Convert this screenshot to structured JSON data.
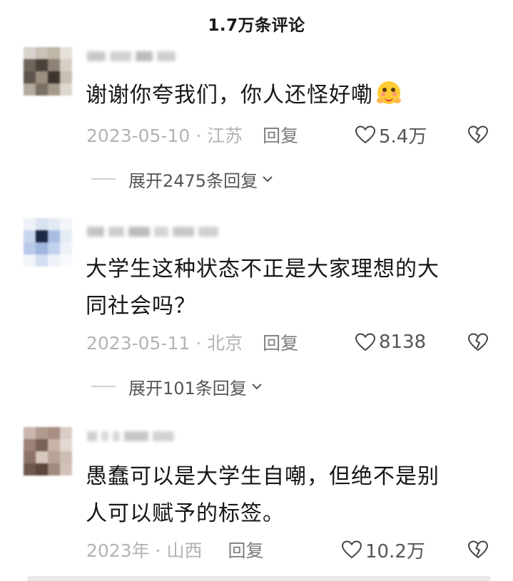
{
  "header": {
    "title": "1.7万条评论"
  },
  "comments": [
    {
      "text": "谢谢你夸我们，你人还怪好嘞",
      "emoji": "hugging-face-icon",
      "date_location": "2023-05-10 · 江苏",
      "reply_label": "回复",
      "likes": "5.4万",
      "expand_label": "展开2475条回复"
    },
    {
      "text": "大学生这种状态不正是大家理想的大\n同社会吗？",
      "date_location": "2023-05-11 · 北京",
      "reply_label": "回复",
      "likes": "8138",
      "expand_label": "展开101条回复"
    },
    {
      "text": "愚蠢可以是大学生自嘲，但绝不是别\n人可以赋予的标签。",
      "date_location": "2023年 · 山西",
      "reply_label": "回复",
      "likes": "10.2万"
    }
  ],
  "icons": {
    "like": "heart-outline-icon",
    "dislike": "broken-heart-icon",
    "expand": "chevron-down-icon"
  },
  "colors": {
    "meta_gray": "#b3b3b3",
    "text": "#161616",
    "background": "#ffffff"
  }
}
